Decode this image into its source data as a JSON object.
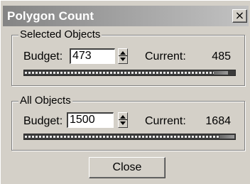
{
  "window": {
    "title": "Polygon Count",
    "close_glyph": "×",
    "close_icon": "close-icon",
    "titlebar_color": "#8a8a8a",
    "background_color": "#d4d0c8"
  },
  "selected_objects": {
    "legend": "Selected Objects",
    "budget_label": "Budget:",
    "budget_value": "473",
    "current_label": "Current:",
    "current_value": "485",
    "usage_fraction": 0.97
  },
  "all_objects": {
    "legend": "All Objects",
    "budget_label": "Budget:",
    "budget_value": "1500",
    "current_label": "Current:",
    "current_value": "1684",
    "usage_fraction": 1.0
  },
  "buttons": {
    "close_label": "Close"
  }
}
